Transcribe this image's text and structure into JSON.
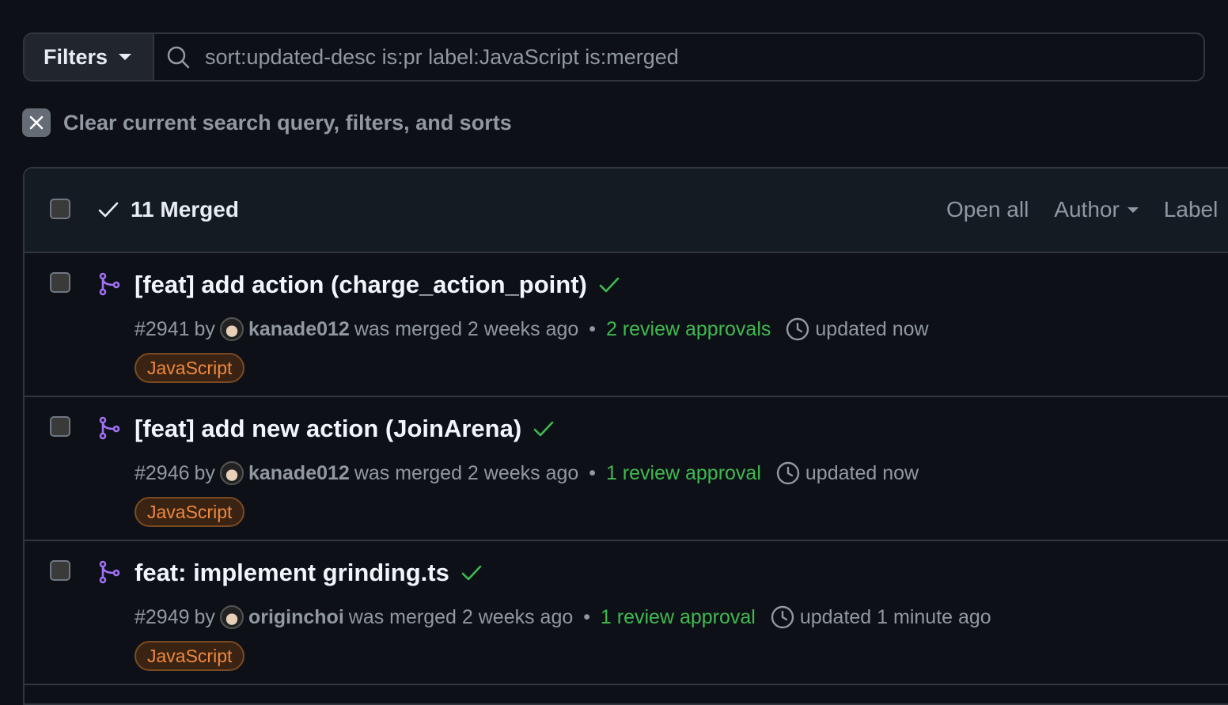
{
  "search": {
    "filters_label": "Filters",
    "query": "sort:updated-desc is:pr label:JavaScript is:merged"
  },
  "clear_label": "Clear current search query, filters, and sorts",
  "list": {
    "merged_count": "11 Merged",
    "actions": {
      "open_all": "Open all",
      "author": "Author",
      "label": "Label"
    },
    "items": [
      {
        "title": "[feat] add action (charge_action_point)",
        "number": "#2941",
        "by": "by",
        "author": "kanade012",
        "merged": "was merged 2 weeks ago",
        "reviews": "2 review approvals",
        "updated": "updated now",
        "label": "JavaScript"
      },
      {
        "title": "[feat] add new action (JoinArena)",
        "number": "#2946",
        "by": "by",
        "author": "kanade012",
        "merged": "was merged 2 weeks ago",
        "reviews": "1 review approval",
        "updated": "updated now",
        "label": "JavaScript"
      },
      {
        "title": "feat: implement grinding.ts",
        "number": "#2949",
        "by": "by",
        "author": "originchoi",
        "merged": "was merged 2 weeks ago",
        "reviews": "1 review approval",
        "updated": "updated 1 minute ago",
        "label": "JavaScript"
      }
    ]
  },
  "colors": {
    "merged_icon": "#a371f7",
    "check": "#3fb950",
    "label_text": "#f0883e"
  }
}
